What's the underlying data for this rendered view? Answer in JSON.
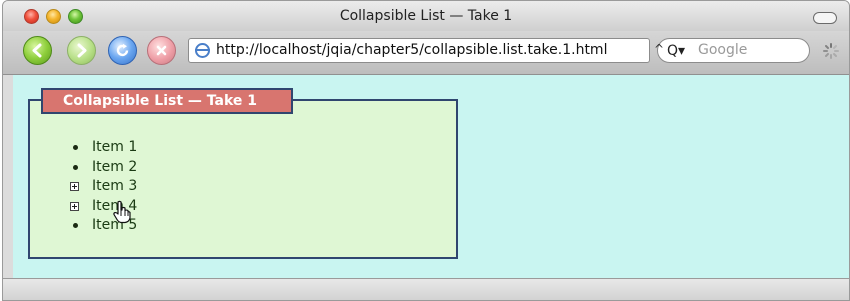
{
  "window": {
    "title": "Collapsible List — Take 1"
  },
  "toolbar": {
    "url": "http://localhost/jqia/chapter5/collapsible.list.take.1.html",
    "search_placeholder": "Google"
  },
  "panel": {
    "legend": "Collapsible List — Take 1",
    "items": [
      {
        "label": "Item 1",
        "marker": "bullet"
      },
      {
        "label": "Item 2",
        "marker": "bullet"
      },
      {
        "label": "Item 3",
        "marker": "plus"
      },
      {
        "label": "Item 4",
        "marker": "plus"
      },
      {
        "label": "Item 5",
        "marker": "bullet"
      }
    ]
  },
  "colors": {
    "content_bg": "#c9f5f1",
    "panel_bg": "#dff7d4",
    "legend_bg": "#d8756f",
    "border": "#30466f"
  },
  "icons": [
    "close-icon",
    "minimize-icon",
    "zoom-icon",
    "back-icon",
    "forward-icon",
    "reload-icon",
    "stop-icon",
    "globe-icon",
    "search-icon",
    "spinner-icon",
    "hand-cursor-icon"
  ]
}
